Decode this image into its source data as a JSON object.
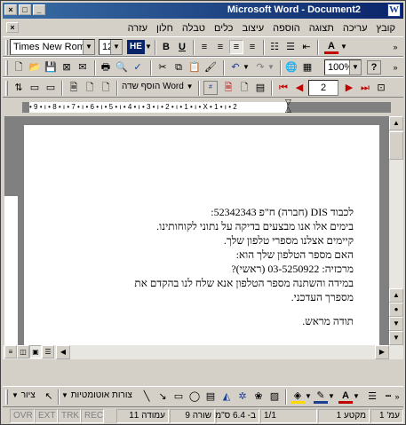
{
  "window": {
    "title": "Microsoft Word - Document2",
    "app_icon": "W",
    "controls": {
      "close": "×",
      "maximize": "□",
      "minimize": "_"
    }
  },
  "menu": {
    "items": [
      "קובץ",
      "עריכה",
      "תצוגה",
      "הוספה",
      "עיצוב",
      "כלים",
      "טבלה",
      "חלון",
      "עזרה"
    ]
  },
  "formatting": {
    "font": "Times New Roman",
    "size": "12",
    "language": "HE",
    "bold": "B",
    "underline": "U",
    "font_color_letter": "A"
  },
  "standard": {
    "zoom": "100%",
    "help": "?"
  },
  "header_footer": {
    "insert_field_label": "הוסף שדה Word",
    "page_number": "2"
  },
  "ruler": {
    "ticks": "• 9 • ı • 8 • ı • 7 • ı • 6 • ı • 5 • ı • 4 • ı • 3 • ı • 2 • ı • 1 • ı • X • 1 • ı • 2"
  },
  "document": {
    "lines": [
      "לכבוד DIS (חברה) ח\"פ 52342343:",
      "בימים אלו אנו מבצעים בדיקה על נתוני לקוחותינו.",
      "קיימים אצלנו מספרי טלפון שלך.",
      "האם מספר הטלפון שלך הוא:",
      "מרכזיה: 03-5250922 (ראשי)?",
      "במידה והשתנה מספר הטלפון אנא שלח לנו בהקדם את",
      "מספרך העדכני."
    ],
    "closing": "תודה מראש."
  },
  "drawing": {
    "draw_label": "ציור",
    "autoshapes_label": "צורות אוטומטיות"
  },
  "status": {
    "page": "עמ' 1",
    "section": "מקטע 1",
    "pages": "1/1",
    "at": "ב- 6.4 ס\"מ",
    "line": "שורה 9",
    "col": "עמודה 11",
    "rec": "REC",
    "trk": "TRK",
    "ext": "EXT",
    "ovr": "OVR"
  }
}
